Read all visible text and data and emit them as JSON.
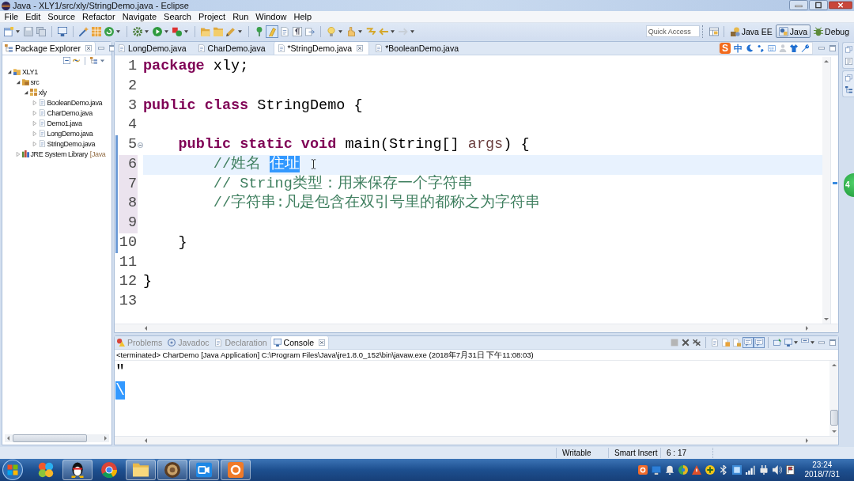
{
  "window": {
    "title": "Java - XLY1/src/xly/StringDemo.java - Eclipse"
  },
  "menu": [
    "File",
    "Edit",
    "Source",
    "Refactor",
    "Navigate",
    "Search",
    "Project",
    "Run",
    "Window",
    "Help"
  ],
  "toolbar": {
    "mark_occurrences": {
      "on": true
    },
    "quick_access": {
      "placeholder": "Quick Access"
    },
    "perspectives": [
      {
        "label": "Java EE",
        "selected": false
      },
      {
        "label": "Java",
        "selected": true
      },
      {
        "label": "Debug",
        "selected": false
      }
    ]
  },
  "package_explorer": {
    "title": "Package Explorer",
    "tree": [
      {
        "label": "XLY1",
        "kind": "project",
        "expanded": true,
        "children": [
          {
            "label": "src",
            "kind": "source-folder",
            "expanded": true,
            "children": [
              {
                "label": "xly",
                "kind": "package",
                "expanded": true,
                "children": [
                  {
                    "label": "BooleanDemo.java",
                    "kind": "java-file",
                    "expanded": false
                  },
                  {
                    "label": "CharDemo.java",
                    "kind": "java-file",
                    "expanded": false
                  },
                  {
                    "label": "Demo1.java",
                    "kind": "java-file",
                    "expanded": false
                  },
                  {
                    "label": "LongDemo.java",
                    "kind": "java-file",
                    "expanded": false
                  },
                  {
                    "label": "StringDemo.java",
                    "kind": "java-file",
                    "expanded": false
                  }
                ]
              }
            ]
          },
          {
            "label": "JRE System Library",
            "decoration": "[Java",
            "kind": "library",
            "expanded": false
          }
        ]
      }
    ]
  },
  "editor": {
    "tabs": [
      {
        "label": "LongDemo.java",
        "selected": false
      },
      {
        "label": "CharDemo.java",
        "selected": false
      },
      {
        "label": "*StringDemo.java",
        "selected": true
      },
      {
        "label": "*BooleanDemo.java",
        "selected": false
      }
    ],
    "ime_toolbar": {
      "logo": "S",
      "mode": "中"
    },
    "lines": [
      {
        "number": "1",
        "current": false,
        "changed": false,
        "fold_range": false,
        "foldable": false,
        "tokens": [
          {
            "kind": "keyword",
            "text": "package"
          },
          {
            "kind": "plain",
            "text": " xly;"
          }
        ]
      },
      {
        "number": "2",
        "current": false,
        "changed": false,
        "fold_range": false,
        "foldable": false
      },
      {
        "number": "3",
        "current": false,
        "changed": false,
        "fold_range": false,
        "foldable": false,
        "tokens": [
          {
            "kind": "keyword",
            "text": "public class"
          },
          {
            "kind": "plain",
            "text": " StringDemo {"
          }
        ]
      },
      {
        "number": "4",
        "current": false,
        "changed": false,
        "fold_range": false,
        "foldable": false
      },
      {
        "number": "5",
        "current": false,
        "changed": false,
        "fold_range": true,
        "foldable": true,
        "tokens": [
          {
            "kind": "keyword",
            "text": "    public static void"
          },
          {
            "kind": "plain",
            "text": " main(String[]"
          },
          {
            "kind": "parameter",
            "text": " args"
          },
          {
            "kind": "plain",
            "text": ") {"
          }
        ]
      },
      {
        "number": "6",
        "current": true,
        "changed": true,
        "fold_range": true,
        "foldable": false,
        "tokens": [
          {
            "kind": "comment",
            "text": "        //姓名 "
          },
          {
            "kind": "selection",
            "text": "住址"
          }
        ]
      },
      {
        "number": "7",
        "current": false,
        "changed": true,
        "fold_range": true,
        "foldable": false,
        "tokens": [
          {
            "kind": "comment",
            "text": "        // String类型：用来保存一个字符串"
          }
        ]
      },
      {
        "number": "8",
        "current": false,
        "changed": true,
        "fold_range": true,
        "foldable": false,
        "tokens": [
          {
            "kind": "comment",
            "text": "        //字符串:凡是包含在双引号里的都称之为字符串"
          }
        ]
      },
      {
        "number": "9",
        "current": false,
        "changed": true,
        "fold_range": true,
        "foldable": false
      },
      {
        "number": "10",
        "current": false,
        "changed": false,
        "fold_range": true,
        "foldable": false,
        "tokens": [
          {
            "kind": "plain",
            "text": "    }"
          }
        ]
      },
      {
        "number": "11",
        "current": false,
        "changed": false,
        "fold_range": false,
        "foldable": false
      },
      {
        "number": "12",
        "current": false,
        "changed": false,
        "fold_range": false,
        "foldable": false,
        "tokens": [
          {
            "kind": "plain",
            "text": "}"
          }
        ]
      },
      {
        "number": "13",
        "current": false,
        "changed": false,
        "fold_range": false,
        "foldable": false
      }
    ]
  },
  "bottom_panel": {
    "tabs": [
      {
        "label": "Problems",
        "selected": false
      },
      {
        "label": "Javadoc",
        "selected": false
      },
      {
        "label": "Declaration",
        "selected": false
      },
      {
        "label": "Console",
        "selected": true
      }
    ],
    "show_on_stdout": {
      "on": true
    },
    "show_on_stderr": {
      "on": true
    },
    "console_header": "<terminated> CharDemo [Java Application] C:\\Program Files\\Java\\jre1.8.0_152\\bin\\javaw.exe (2018年7月31日 下午11:08:03)",
    "console_lines": [
      {
        "text": "\"",
        "selected": false
      },
      {
        "text": "\\",
        "selected": true
      }
    ]
  },
  "status_bar": [
    "Writable",
    "Smart Insert",
    "6 : 17"
  ],
  "floating_ball": {
    "text": "4"
  },
  "taskbar": {
    "apps": [
      {
        "running": false
      },
      {
        "running": true
      },
      {
        "running": false
      },
      {
        "running": true
      },
      {
        "running": true
      },
      {
        "running": true
      },
      {
        "running": true
      }
    ],
    "time": "23:24",
    "date": "2018/7/31"
  }
}
